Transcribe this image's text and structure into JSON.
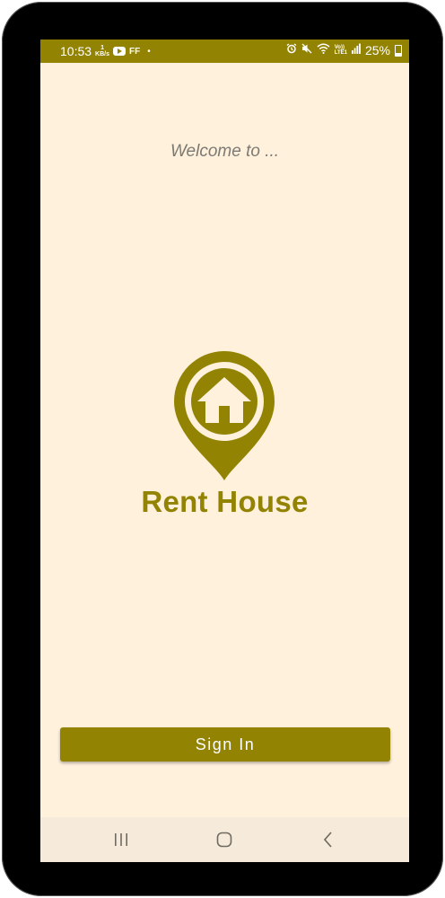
{
  "status_bar": {
    "time": "10:53",
    "net_speed_value": "1",
    "net_speed_unit": "KB/s",
    "ff_label": "FF",
    "dot": "•",
    "lte_top": "Vo))",
    "lte_bottom": "LTE1",
    "battery_percent": "25%",
    "icons": [
      "youtube-icon",
      "alarm-icon",
      "mute-icon",
      "wifi-icon",
      "signal-icon",
      "battery-icon"
    ]
  },
  "welcome_text": "Welcome to ...",
  "app_name": "Rent House",
  "sign_in_label": "Sign In",
  "nav_bar": {
    "icons": [
      "recents-icon",
      "home-icon",
      "back-icon"
    ]
  },
  "colors": {
    "primary": "#938302",
    "background": "#FFF1DC",
    "nav_background": "#F6EBDA",
    "welcome_text": "#7d7a74"
  }
}
